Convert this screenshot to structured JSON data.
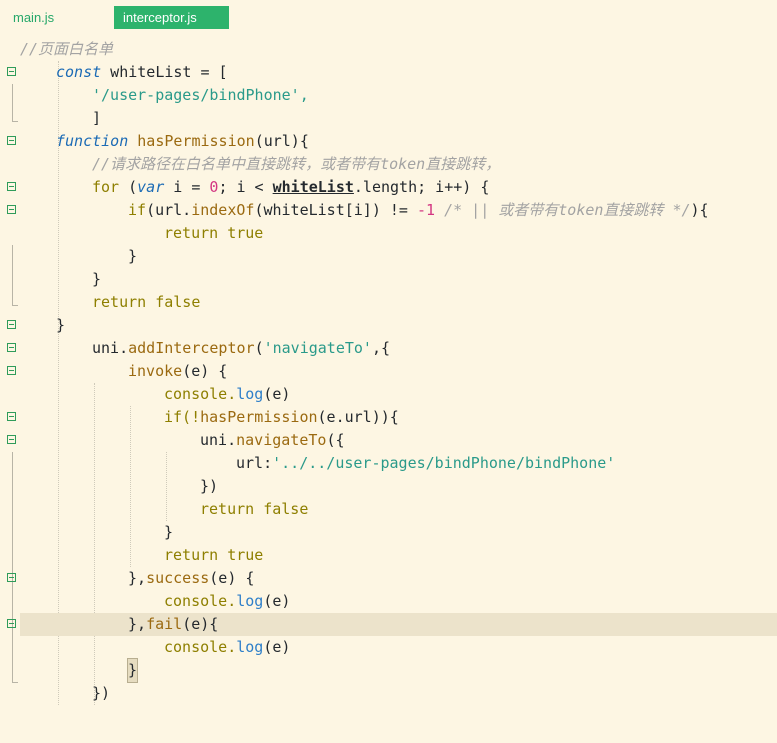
{
  "tabs": {
    "inactive_label": "main.js",
    "active_label": "interceptor.js"
  },
  "code": {
    "comment_whitelist": "//页面白名单",
    "const_kw": "const",
    "whitelist_decl": " whiteList = [",
    "whitelist_item": "'/user-pages/bindPhone',",
    "array_close": "]",
    "function_kw": "function",
    "fn_name": "hasPermission",
    "fn_params": "(url){",
    "comment_check": "//请求路径在白名单中直接跳转，或者带有token直接跳转，",
    "for_kw": "for",
    "for_open": " (",
    "var_kw": "var",
    "for_init": " i = ",
    "zero": "0",
    "for_cond": "; i < ",
    "whitelist_ref": "whiteList",
    "for_rest": ".length; i++) {",
    "if_kw": "if",
    "if_open": "(url.",
    "index_of": "indexOf",
    "if_mid": "(whiteList[i]) != ",
    "minus_one": "-1",
    "if_comment": " /* || 或者带有token直接跳转 */",
    "if_close": "){",
    "return_true": "return true",
    "close_brace": "}",
    "return_false": "return false",
    "uni_obj": "uni.",
    "add_interceptor": "addInterceptor",
    "add_interceptor_open": "(",
    "navigate_to_str": "'navigateTo'",
    "add_interceptor_rest": ",{",
    "invoke": "invoke",
    "invoke_params": "(e) {",
    "console_obj": "console.",
    "log_fn": "log",
    "log_args": "(e)",
    "if_not": "if(!",
    "has_permission_call": "hasPermission",
    "if_not_rest": "(e.url)){",
    "uni_navigate_obj": "uni.",
    "navigate_to": "navigateTo",
    "navigate_open": "({",
    "url_key": "url:",
    "url_value": "'../../user-pages/bindPhone/bindPhone'",
    "navigate_close": "})",
    "success_open": "},",
    "success": "success",
    "success_params": "(e) {",
    "fail_open": "},",
    "fail": "fail",
    "fail_params": "(e){",
    "interceptor_close": "})"
  }
}
